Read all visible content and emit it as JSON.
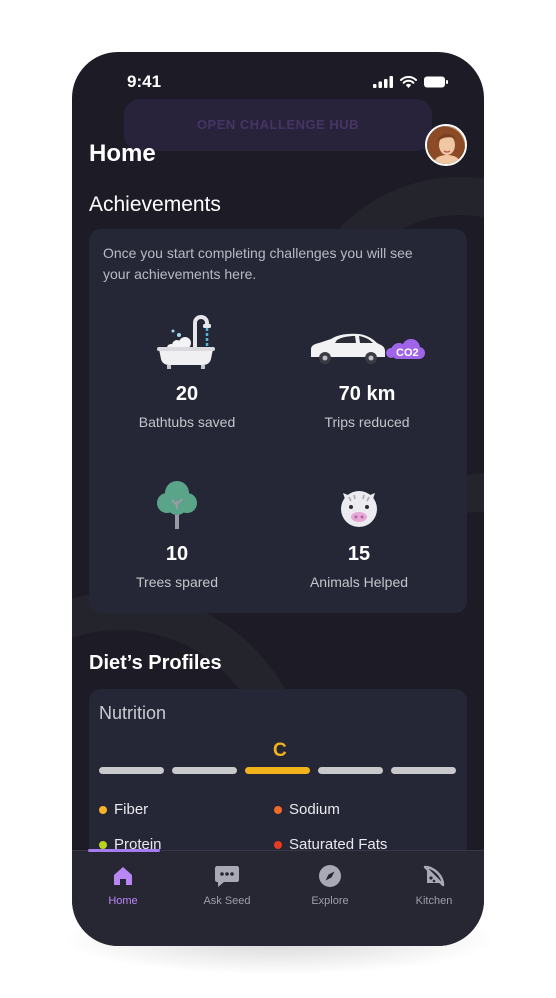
{
  "status_bar": {
    "time": "9:41"
  },
  "ghost_banner": {
    "label": "OPEN CHALLENGE HUB"
  },
  "header": {
    "title": "Home"
  },
  "achievements": {
    "title": "Achievements",
    "intro": "Once you start completing challenges you will see your achievements here.",
    "items": [
      {
        "value": "20",
        "label": "Bathtubs saved",
        "icon": "bathtub-icon"
      },
      {
        "value": "70 km",
        "label": "Trips reduced",
        "icon": "car-co2-icon",
        "badge": "CO2"
      },
      {
        "value": "10",
        "label": "Trees spared",
        "icon": "tree-icon"
      },
      {
        "value": "15",
        "label": "Animals Helped",
        "icon": "pig-icon"
      }
    ]
  },
  "diet": {
    "title": "Diet’s Profiles",
    "nutrition_label": "Nutrition",
    "grade": "C",
    "grade_levels": 5,
    "active_level": 3,
    "legend": [
      {
        "label": "Fiber",
        "color": "#f5b325"
      },
      {
        "label": "Sodium",
        "color": "#ee6a26"
      },
      {
        "label": "Protein",
        "color": "#b8d41c"
      },
      {
        "label": "Saturated Fats",
        "color": "#e83b21"
      }
    ]
  },
  "tabs": [
    {
      "label": "Home",
      "icon": "home-icon",
      "active": true
    },
    {
      "label": "Ask Seed",
      "icon": "chat-icon",
      "active": false
    },
    {
      "label": "Explore",
      "icon": "compass-icon",
      "active": false
    },
    {
      "label": "Kitchen",
      "icon": "pizza-icon",
      "active": false
    }
  ],
  "colors": {
    "background": "#1d1c26",
    "card": "#262736",
    "accent": "#a77bf0",
    "grade": "#f2b21b"
  }
}
